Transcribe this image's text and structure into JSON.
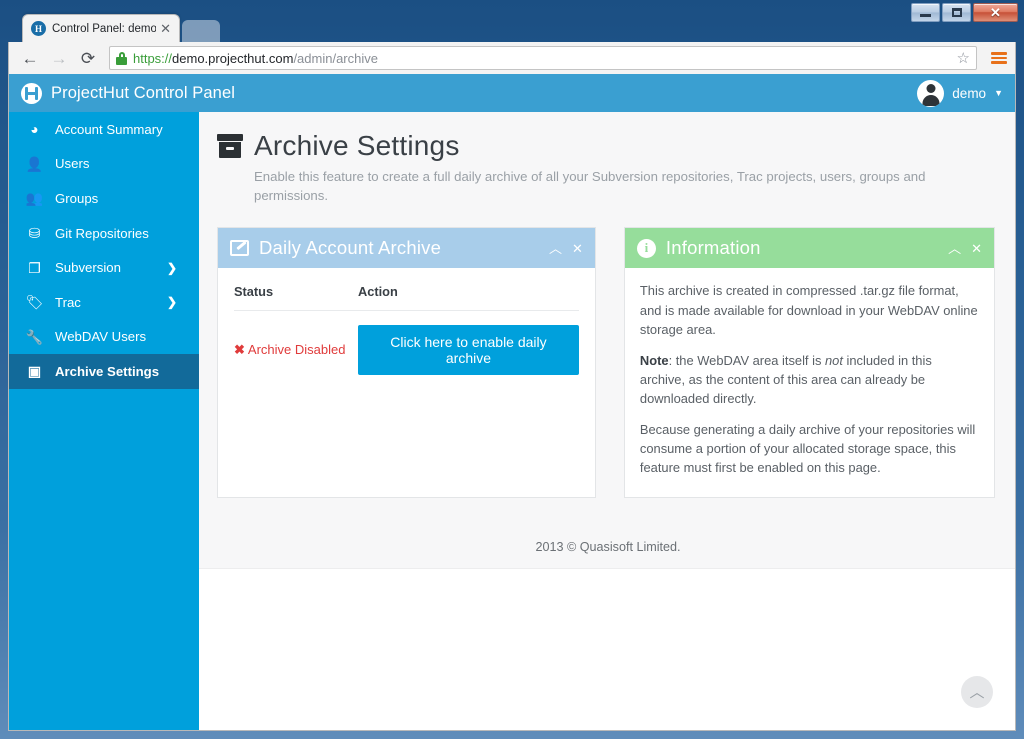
{
  "window": {
    "minimize_label": "Minimize",
    "maximize_label": "Maximize",
    "close_label": "✕"
  },
  "browser": {
    "tab": {
      "title": "Control Panel: demo - Arc",
      "favicon_glyph": "H",
      "close_label": "✕"
    },
    "nav": {
      "back": "←",
      "forward": "→",
      "reload": "⟳"
    },
    "omnibox": {
      "scheme": "https://",
      "host": "demo.projecthut.com",
      "path": "/admin/archive",
      "star_label": "☆"
    }
  },
  "appbar": {
    "brand_title": "ProjectHut Control Panel",
    "username": "demo",
    "caret": "▼"
  },
  "sidebar": {
    "items": [
      {
        "label": "Account Summary",
        "icon": "dashboard-icon",
        "glyph": "◕",
        "chevron": "",
        "active": false
      },
      {
        "label": "Users",
        "icon": "user-icon",
        "glyph": "👤",
        "chevron": "",
        "active": false
      },
      {
        "label": "Groups",
        "icon": "group-icon",
        "glyph": "👥",
        "chevron": "",
        "active": false
      },
      {
        "label": "Git Repositories",
        "icon": "sitemap-icon",
        "glyph": "⛁",
        "chevron": "",
        "active": false
      },
      {
        "label": "Subversion",
        "icon": "copy-icon",
        "glyph": "❐",
        "chevron": "❯",
        "active": false
      },
      {
        "label": "Trac",
        "icon": "tags-icon",
        "glyph": "🏷",
        "chevron": "❯",
        "active": false
      },
      {
        "label": "WebDAV Users",
        "icon": "wrench-icon",
        "glyph": "🔧",
        "chevron": "",
        "active": false
      },
      {
        "label": "Archive Settings",
        "icon": "archive-icon",
        "glyph": "▣",
        "chevron": "",
        "active": true
      }
    ]
  },
  "page": {
    "title": "Archive Settings",
    "subtitle": "Enable this feature to create a full daily archive of all your Subversion repositories, Trac projects, users, groups and permissions."
  },
  "panel_archive": {
    "title": "Daily Account Archive",
    "collapse_label": "︿",
    "close_label": "✕",
    "columns": [
      "Status",
      "Action"
    ],
    "status_text": "Archive Disabled",
    "status_mark": "✖",
    "button_label": "Click here to enable daily archive"
  },
  "panel_info": {
    "title": "Information",
    "collapse_label": "︿",
    "close_label": "✕",
    "paragraph_1": "This archive is created in compressed .tar.gz file format, and is made available for download in your WebDAV online storage area.",
    "paragraph_2_bold": "Note",
    "paragraph_2_a": ": the WebDAV area itself is ",
    "paragraph_2_italic": "not",
    "paragraph_2_b": " included in this archive, as the content of this area can already be downloaded directly.",
    "paragraph_3": "Because generating a daily archive of your repositories will consume a portion of your allocated storage space, this feature must first be enabled on this page."
  },
  "footer": {
    "copyright": "2013 © Quasisoft Limited."
  },
  "scroll_top": {
    "label": "︿"
  },
  "colors": {
    "accent_blue": "#00a0dc",
    "appbar_blue": "#3a9fd1",
    "active_nav": "#126a9a",
    "panel_blue_header": "#a8cdea",
    "panel_green_header": "#96dd9b",
    "status_red": "#e03b3b",
    "page_bg": "#f7f7f8"
  }
}
